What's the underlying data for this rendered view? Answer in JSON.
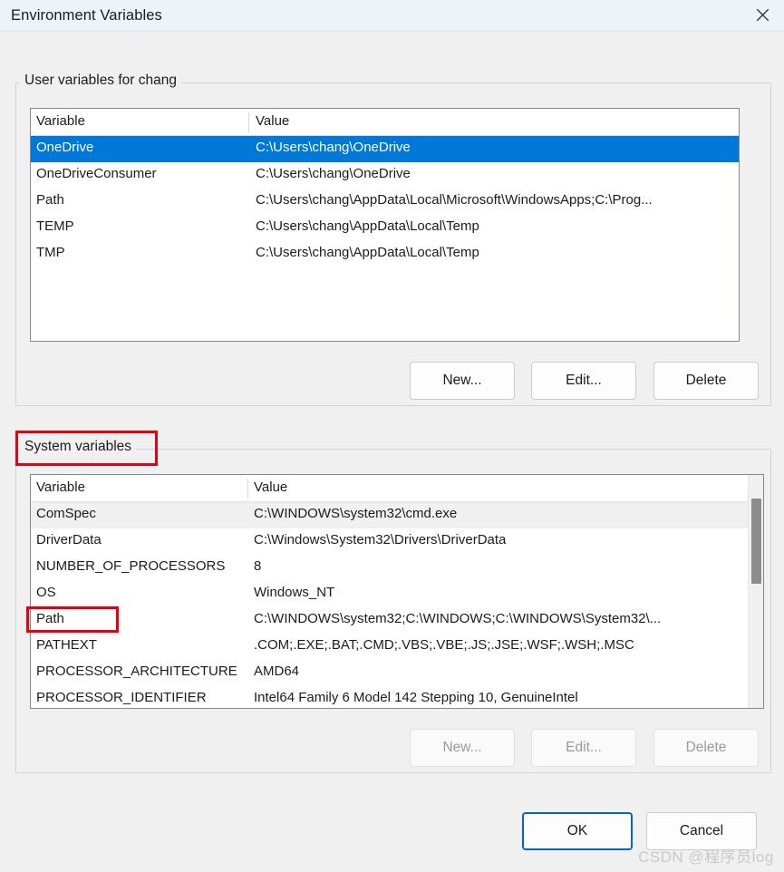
{
  "window": {
    "title": "Environment Variables",
    "close_icon": "close-icon"
  },
  "user_section": {
    "legend": "User variables for chang",
    "columns": [
      "Variable",
      "Value"
    ],
    "rows": [
      {
        "variable": "OneDrive",
        "value": "C:\\Users\\chang\\OneDrive",
        "selected": true
      },
      {
        "variable": "OneDriveConsumer",
        "value": "C:\\Users\\chang\\OneDrive",
        "selected": false
      },
      {
        "variable": "Path",
        "value": "C:\\Users\\chang\\AppData\\Local\\Microsoft\\WindowsApps;C:\\Prog...",
        "selected": false
      },
      {
        "variable": "TEMP",
        "value": "C:\\Users\\chang\\AppData\\Local\\Temp",
        "selected": false
      },
      {
        "variable": "TMP",
        "value": "C:\\Users\\chang\\AppData\\Local\\Temp",
        "selected": false
      }
    ],
    "buttons": {
      "new": "New...",
      "edit": "Edit...",
      "delete": "Delete"
    }
  },
  "system_section": {
    "legend": "System variables",
    "columns": [
      "Variable",
      "Value"
    ],
    "rows": [
      {
        "variable": "ComSpec",
        "value": "C:\\WINDOWS\\system32\\cmd.exe"
      },
      {
        "variable": "DriverData",
        "value": "C:\\Windows\\System32\\Drivers\\DriverData"
      },
      {
        "variable": "NUMBER_OF_PROCESSORS",
        "value": "8"
      },
      {
        "variable": "OS",
        "value": "Windows_NT"
      },
      {
        "variable": "Path",
        "value": "C:\\WINDOWS\\system32;C:\\WINDOWS;C:\\WINDOWS\\System32\\..."
      },
      {
        "variable": "PATHEXT",
        "value": ".COM;.EXE;.BAT;.CMD;.VBS;.VBE;.JS;.JSE;.WSF;.WSH;.MSC"
      },
      {
        "variable": "PROCESSOR_ARCHITECTURE",
        "value": "AMD64"
      },
      {
        "variable": "PROCESSOR_IDENTIFIER",
        "value": "Intel64 Family 6 Model 142 Stepping 10, GenuineIntel"
      }
    ],
    "buttons": {
      "new": "New...",
      "edit": "Edit...",
      "delete": "Delete"
    }
  },
  "dialog_buttons": {
    "ok": "OK",
    "cancel": "Cancel"
  },
  "annotations": {
    "highlight_color": "#e60012",
    "boxes": [
      "system-variables-legend",
      "system-path-row"
    ]
  },
  "watermark": {
    "text": "CSDN @程序员log"
  },
  "colors": {
    "selection": "#0078d7",
    "accent": "#0067c0",
    "titlebar": "#eef3f7",
    "dialog_bg": "#f0f0f0"
  }
}
